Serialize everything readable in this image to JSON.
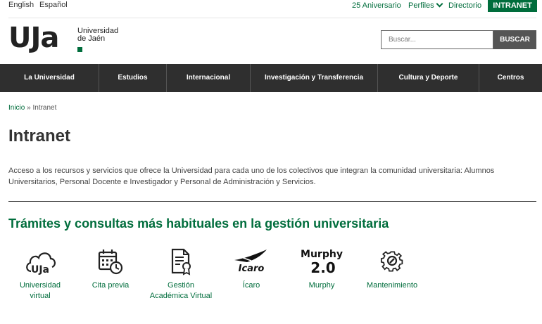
{
  "topbar": {
    "languages": [
      "English",
      "Español"
    ],
    "links": {
      "aniversario": "25 Aniversario",
      "perfiles": "Perfiles",
      "directorio": "Directorio"
    },
    "intranet_button": "INTRANET"
  },
  "logo": {
    "mark": "UJa",
    "text_line1": "Universidad",
    "text_line2": "de Jaén"
  },
  "search": {
    "placeholder": "Buscar...",
    "button": "BUSCAR"
  },
  "nav": {
    "items": [
      "La Universidad",
      "Estudios",
      "Internacional",
      "Investigación y Transferencia",
      "Cultura y Deporte",
      "Centros"
    ]
  },
  "breadcrumb": {
    "home": "Inicio",
    "separator": "»",
    "current": "Intranet"
  },
  "page": {
    "title": "Intranet",
    "intro": "Acceso a los recursos y servicios que ofrece la Universidad para cada uno de los colectivos que integran la comunidad universitaria: Alumnos Universitarios, Personal Docente e Investigador y Personal de Administración y Servicios.",
    "section_title": "Trámites y consultas más habituales en la gestión universitaria"
  },
  "services": [
    {
      "label": "Universidad virtual",
      "icon": "cloud-uja-icon",
      "icon_text": "UJa"
    },
    {
      "label": "Cita previa",
      "icon": "calendar-clock-icon"
    },
    {
      "label": "Gestión Académica Virtual",
      "icon": "certificate-document-icon"
    },
    {
      "label": "Ícaro",
      "icon": "icaro-logo-icon",
      "icon_text": "Icaro"
    },
    {
      "label": "Murphy",
      "icon": "murphy-logo-icon",
      "icon_text": "Murphy",
      "icon_text2": "2.0"
    },
    {
      "label": "Mantenimiento",
      "icon": "gear-wrench-icon"
    }
  ],
  "colors": {
    "brand_green": "#006d3c",
    "nav_background": "#2f2f2f",
    "search_button": "#555555"
  }
}
